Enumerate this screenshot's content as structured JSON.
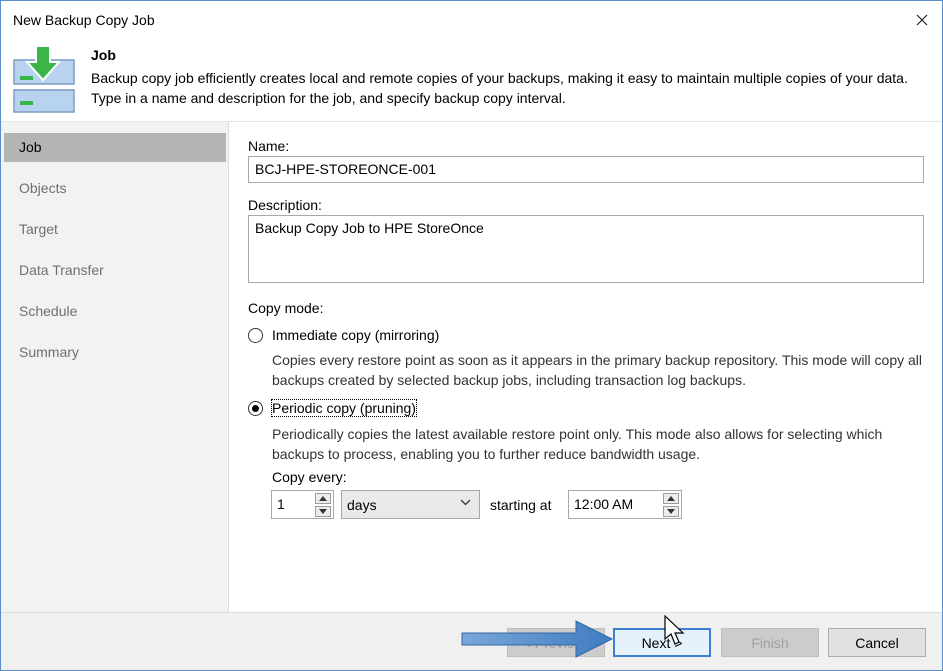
{
  "window": {
    "title": "New Backup Copy Job"
  },
  "header": {
    "title": "Job",
    "description": "Backup copy job efficiently creates local and remote copies of your backups, making it easy to maintain multiple copies of your data. Type in a name and description for the job, and specify backup copy interval."
  },
  "sidebar": {
    "items": [
      {
        "label": "Job",
        "active": true
      },
      {
        "label": "Objects"
      },
      {
        "label": "Target"
      },
      {
        "label": "Data Transfer"
      },
      {
        "label": "Schedule"
      },
      {
        "label": "Summary"
      }
    ]
  },
  "form": {
    "name_label": "Name:",
    "name_value": "BCJ-HPE-STOREONCE-001",
    "description_label": "Description:",
    "description_value": "Backup Copy Job to HPE StoreOnce",
    "copy_mode_label": "Copy mode:",
    "immediate": {
      "label": "Immediate copy (mirroring)",
      "selected": false,
      "description": "Copies every restore point as soon as it appears in the primary backup repository. This mode will copy all backups created by selected backup jobs, including transaction log backups."
    },
    "periodic": {
      "label": "Periodic copy (pruning)",
      "selected": true,
      "description": "Periodically copies the latest available restore point only. This mode also allows for selecting which backups to process, enabling you to further reduce bandwidth usage."
    },
    "copy_every_label": "Copy every:",
    "copy_every_value": "1",
    "unit_value": "days",
    "starting_at_label": "starting at",
    "time_value": "12:00 AM"
  },
  "footer": {
    "previous_label": "< Previous",
    "next_label": "Next >",
    "finish_label": "Finish",
    "cancel_label": "Cancel"
  },
  "colors": {
    "accent": "#3c7fd0",
    "sidebar_bg": "#f2f2f2",
    "sidebar_active": "#b4b4b4",
    "arrow": "#4a86c8",
    "icon_green": "#39b54a",
    "icon_blue": "#b7d3ef"
  }
}
